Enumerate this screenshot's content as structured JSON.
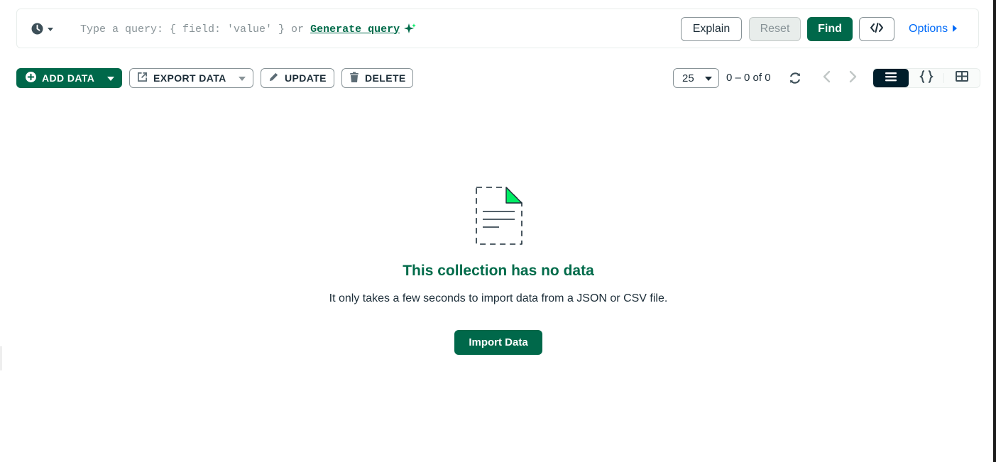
{
  "query_bar": {
    "placeholder": "Type a query: { field: 'value' } or",
    "generate_link": "Generate query",
    "explain_label": "Explain",
    "reset_label": "Reset",
    "find_label": "Find",
    "options_label": "Options"
  },
  "toolbar": {
    "add_data_label": "ADD DATA",
    "export_data_label": "EXPORT DATA",
    "update_label": "UPDATE",
    "delete_label": "DELETE",
    "page_size": "25",
    "range_text": "0 – 0 of 0"
  },
  "empty_state": {
    "title": "This collection has no data",
    "description": "It only takes a few seconds to import data from a JSON or CSV file.",
    "import_label": "Import Data"
  },
  "colors": {
    "brand_green": "#00684a",
    "accent_green": "#00ed64",
    "link_blue": "#016bf8",
    "dark_navy": "#001e2b"
  },
  "icons": [
    "history-clock-icon",
    "sparkle-icon",
    "code-icon",
    "caret-right-icon",
    "plus-circle-icon",
    "export-icon",
    "pencil-icon",
    "trash-icon",
    "refresh-icon",
    "chevron-left-icon",
    "chevron-right-icon",
    "list-view-icon",
    "json-view-icon",
    "table-view-icon",
    "empty-document-icon"
  ]
}
